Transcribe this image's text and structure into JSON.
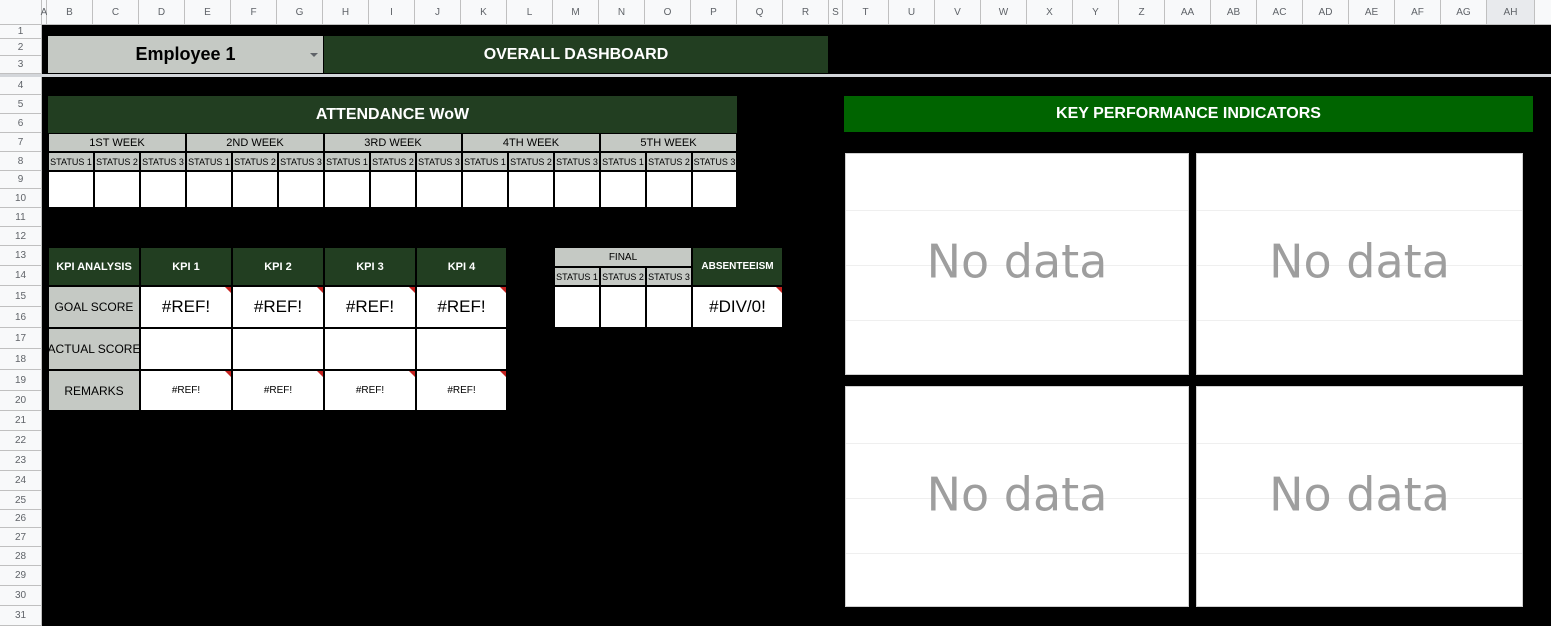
{
  "grid": {
    "columns": [
      "A",
      "B",
      "C",
      "D",
      "E",
      "F",
      "G",
      "H",
      "I",
      "J",
      "K",
      "L",
      "M",
      "N",
      "O",
      "P",
      "Q",
      "R",
      "S",
      "T",
      "U",
      "V",
      "W",
      "X",
      "Y",
      "Z",
      "AA",
      "AB",
      "AC",
      "AD",
      "AE",
      "AF",
      "AG",
      "AH"
    ],
    "rows": [
      "1",
      "2",
      "3",
      "4",
      "5",
      "6",
      "7",
      "8",
      "9",
      "10",
      "11",
      "12",
      "13",
      "14",
      "15",
      "16",
      "17",
      "18",
      "19",
      "20",
      "21",
      "22",
      "23",
      "24",
      "25",
      "26",
      "27",
      "28",
      "29",
      "30",
      "31"
    ],
    "selected_column": "AH"
  },
  "header": {
    "employee_select": "Employee 1",
    "title": "OVERALL DASHBOARD"
  },
  "attendance": {
    "title": "ATTENDANCE WoW",
    "weeks": [
      "1ST WEEK",
      "2ND WEEK",
      "3RD WEEK",
      "4TH WEEK",
      "5TH WEEK"
    ],
    "status_labels": [
      "STATUS 1",
      "STATUS 2",
      "STATUS 3"
    ]
  },
  "kpi_table": {
    "corner": "KPI ANALYSIS",
    "columns": [
      "KPI 1",
      "KPI 2",
      "KPI 3",
      "KPI 4"
    ],
    "rows": [
      {
        "label": "GOAL SCORE",
        "values": [
          "#REF!",
          "#REF!",
          "#REF!",
          "#REF!"
        ]
      },
      {
        "label": "ACTUAL SCORE",
        "values": [
          "",
          "",
          "",
          ""
        ]
      },
      {
        "label": "REMARKS",
        "values": [
          "#REF!",
          "#REF!",
          "#REF!",
          "#REF!"
        ]
      }
    ]
  },
  "final": {
    "title": "FINAL",
    "status_labels": [
      "STATUS 1",
      "STATUS 2",
      "STATUS 3"
    ],
    "absenteeism_label": "ABSENTEEISM",
    "absenteeism_value": "#DIV/0!"
  },
  "kpi_panel": {
    "title": "KEY PERFORMANCE INDICATORS",
    "charts": [
      {
        "message": "No data"
      },
      {
        "message": "No data"
      },
      {
        "message": "No data"
      },
      {
        "message": "No data"
      }
    ]
  },
  "colors": {
    "dark_green": "#223e21",
    "kpi_green": "#006400",
    "gray_fill": "#c5c9c4",
    "error_marker": "#c5221f"
  }
}
